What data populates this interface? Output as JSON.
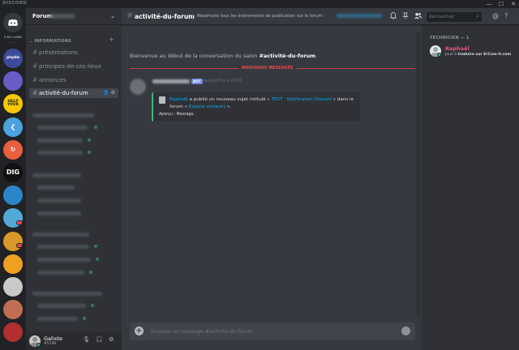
{
  "window": {
    "app_title": "DISCORD",
    "minimize_glyph": "—",
    "maximize_glyph": "☐",
    "close_glyph": "✕"
  },
  "guilds": {
    "online_label": "0 EN LIGNE",
    "items": [
      {
        "icon": "phpbb-logo",
        "color": "#3b4b9a",
        "text": "phpbb"
      },
      {
        "icon": "swirl-logo",
        "color": "#6a5cc4",
        "text": ""
      },
      {
        "icon": "help-your-logo",
        "color": "#f7c800",
        "text": "HELP YOUR"
      },
      {
        "icon": "chevron-logo",
        "color": "#4aa3df",
        "text": "❮"
      },
      {
        "icon": "refresh-logo",
        "color": "#e8603c",
        "text": "↻"
      },
      {
        "icon": "dig-logo",
        "color": "#111111",
        "text": "DIG"
      },
      {
        "icon": "globe-logo",
        "color": "#2b86c9",
        "text": ""
      },
      {
        "icon": "triangle-logo",
        "color": "#52a9d8",
        "text": ""
      },
      {
        "icon": "coin-logo",
        "color": "#d99a2b",
        "text": ""
      },
      {
        "icon": "orange-logo",
        "color": "#f0a020",
        "text": ""
      },
      {
        "icon": "shield-logo",
        "color": "#c9c9c9",
        "text": ""
      },
      {
        "icon": "portrait-logo",
        "color": "#c06e52",
        "text": ""
      },
      {
        "icon": "red-logo",
        "color": "#b22f2f",
        "text": ""
      }
    ]
  },
  "server": {
    "name": "Forum"
  },
  "sidebar": {
    "category": "INFORMATIONS",
    "channels": [
      {
        "name": "présentations",
        "active": false
      },
      {
        "name": "principes-de-ces-lieux",
        "active": false
      },
      {
        "name": "annonces",
        "active": false
      },
      {
        "name": "activité-du-forum",
        "active": true
      }
    ]
  },
  "user": {
    "name": "Galixte",
    "tag": "#5746"
  },
  "channel": {
    "name": "activité-du-forum",
    "topic": "Répertoire tous les évènements de publication sur le forum :"
  },
  "search": {
    "placeholder": "Rechercher"
  },
  "messages": {
    "welcome_prefix": "Bienvenue au début de la conversation du salon ",
    "welcome_channel": "#activité-du-forum",
    "welcome_suffix": ".",
    "new_label": "NOUVEAUX MESSAGES",
    "bot_badge": "BOT",
    "timestamp": "Aujourd'hui à 20:55",
    "embed": {
      "author": "Raphaël",
      "text1": " a publié un nouveau sujet intitulé « ",
      "topic_link": "TEST : Notification Discord",
      "text2": " » dans le forum « ",
      "forum_link": "Espace visiteurs",
      "text3": " ».",
      "footer": "Aperçu : Message."
    }
  },
  "composer": {
    "placeholder": "Envoyer un message #activité-du-forum"
  },
  "members": {
    "category": "TECHNICIEN — 1",
    "items": [
      {
        "name": "Raphaël",
        "activity_prefix": "Joue à ",
        "activity_game": "traduire sur ErCom-fr.com"
      }
    ]
  },
  "colors": {
    "accent": "#7289da",
    "online": "#43b581",
    "new_messages": "#f04747",
    "link": "#00b0f4",
    "member_role": "#e9577a"
  }
}
